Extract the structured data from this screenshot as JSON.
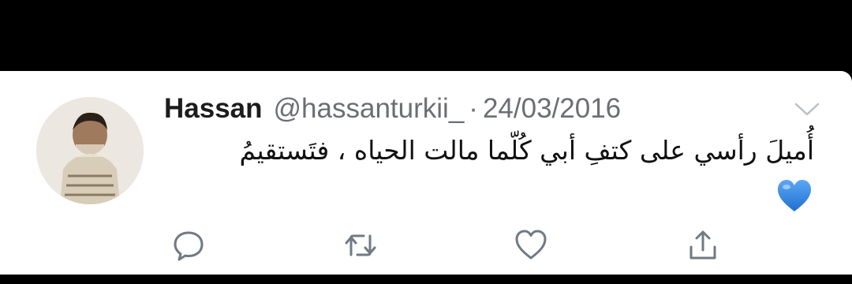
{
  "tweet": {
    "author_name": "Hassan",
    "handle": "@hassanturkii_",
    "separator": "·",
    "date": "24/03/2016",
    "text": "أُميلَ رأسي على كتفِ أبي كُلّما مالت الحياه ، فتَستقيمُ",
    "emoji": "blue-heart"
  },
  "actions": [
    {
      "name": "reply",
      "icon": "speech-bubble-icon"
    },
    {
      "name": "retweet",
      "icon": "retweet-icon"
    },
    {
      "name": "like",
      "icon": "heart-icon"
    },
    {
      "name": "share",
      "icon": "share-icon"
    }
  ],
  "colors": {
    "text": "#111111",
    "secondary": "#6b6f73",
    "icon": "#6f7a84",
    "emoji_blue": "#3a8fe8"
  }
}
